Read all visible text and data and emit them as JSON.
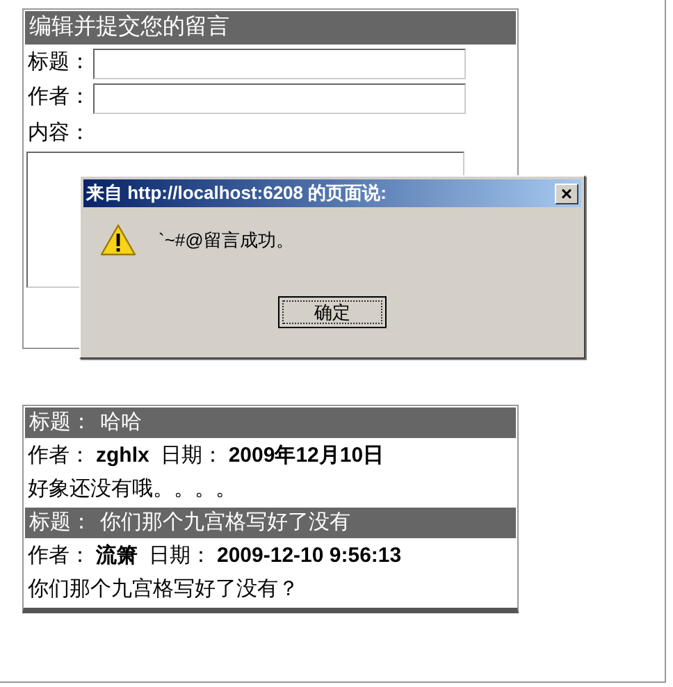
{
  "form": {
    "title": "编辑并提交您的留言",
    "fields": [
      {
        "label": "标题："
      },
      {
        "label": "作者："
      }
    ],
    "content_label": "内容："
  },
  "dialog": {
    "title": "来自 http://localhost:6208 的页面说:",
    "close": "×",
    "message": "`~#@留言成功。",
    "button": "确定"
  },
  "messages": [
    {
      "title_label": "标题：",
      "title": "哈哈",
      "author_label": "作者：",
      "author": "zghlx",
      "date_label": "日期：",
      "date": "2009年12月10日",
      "body": "好象还没有哦。。。。"
    },
    {
      "title_label": "标题：",
      "title": "你们那个九宫格写好了没有",
      "author_label": "作者：",
      "author": "流箫",
      "date_label": "日期：",
      "date": "2009-12-10 9:56:13",
      "body": "你们那个九宫格写好了没有？"
    }
  ]
}
